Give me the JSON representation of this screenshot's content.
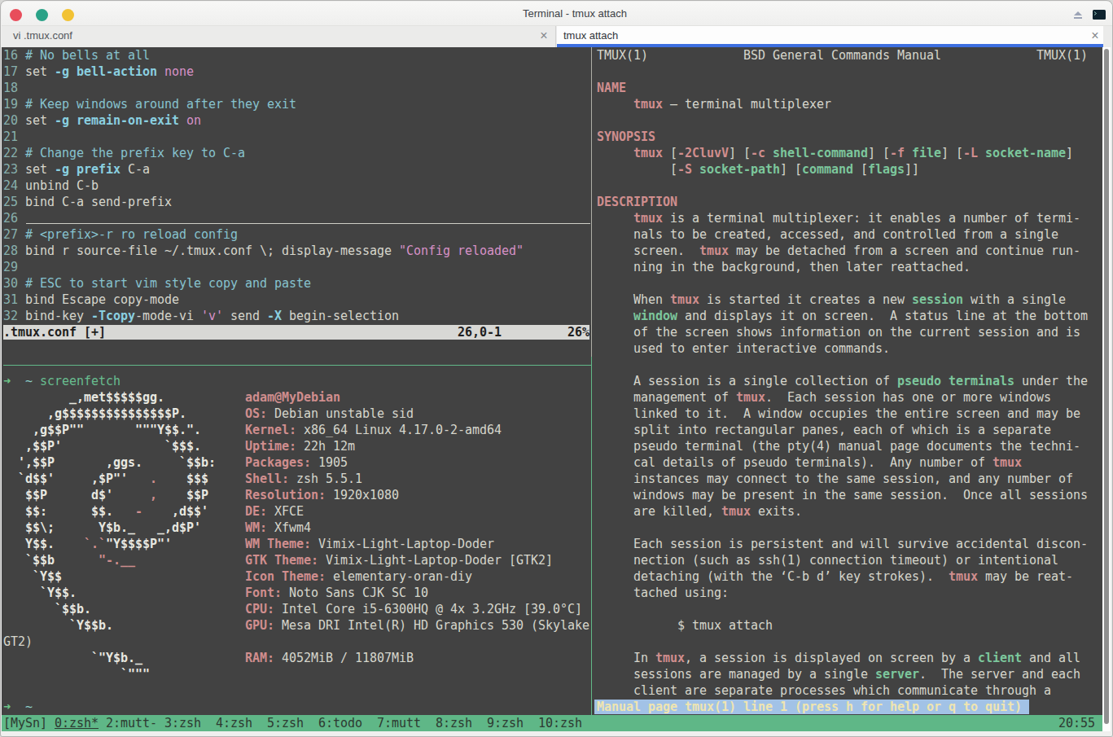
{
  "window": {
    "title": "Terminal - tmux attach",
    "controls": {
      "close": "close",
      "maximize": "maximize",
      "minimize": "minimize"
    },
    "icons": [
      "shade-icon",
      "terminal-app-icon"
    ]
  },
  "tabs": [
    {
      "label": "vi .tmux.conf",
      "close_label": "×",
      "active": false
    },
    {
      "label": "tmux attach",
      "close_label": "×",
      "active": true
    }
  ],
  "colors": {
    "terminal_bg": "#424242",
    "foreground": "#d6d6cc",
    "accent_blue_tab": "#3d6fe0",
    "tmux_statusbar_green": "#5fb787",
    "pager_highlight_blue": "#a2c2e6",
    "salmon": "#d08e8e",
    "green_bold": "#7cc79c",
    "cyan_keyword": "#8ad0e0",
    "pink": "#d791c7",
    "traffic_red": "#e84d5b",
    "traffic_green": "#2aa287",
    "traffic_yellow": "#f2c233"
  },
  "terminal": {
    "vim_pane": {
      "rows": [
        [
          [
            "ln",
            "16 "
          ],
          [
            "cm",
            "# No bells at all"
          ]
        ],
        [
          [
            "ln",
            "17 "
          ],
          [
            "d",
            "set "
          ],
          [
            "kw",
            "-g"
          ],
          [
            "d",
            " "
          ],
          [
            "kw",
            "bell-action"
          ],
          [
            "d",
            " "
          ],
          [
            "pk",
            "none"
          ]
        ],
        [
          [
            "ln",
            "18"
          ]
        ],
        [
          [
            "ln",
            "19 "
          ],
          [
            "cm",
            "# Keep windows around after they exit"
          ]
        ],
        [
          [
            "ln",
            "20 "
          ],
          [
            "d",
            "set "
          ],
          [
            "kw",
            "-g"
          ],
          [
            "d",
            " "
          ],
          [
            "kw",
            "remain-on-exit"
          ],
          [
            "d",
            " "
          ],
          [
            "pk",
            "on"
          ]
        ],
        [
          [
            "ln",
            "21"
          ]
        ],
        [
          [
            "ln",
            "22 "
          ],
          [
            "cm",
            "# Change the prefix key to C-a"
          ]
        ],
        [
          [
            "ln",
            "23 "
          ],
          [
            "d",
            "set "
          ],
          [
            "kw",
            "-g"
          ],
          [
            "d",
            " "
          ],
          [
            "kw",
            "prefix"
          ],
          [
            "d",
            " C-a"
          ]
        ],
        [
          [
            "ln",
            "24 "
          ],
          [
            "d",
            "unbind C-b"
          ]
        ],
        [
          [
            "ln",
            "25 "
          ],
          [
            "d",
            "bind C-a send-prefix"
          ]
        ],
        [
          [
            "ln",
            "26 "
          ]
        ],
        [
          [
            "ln",
            "27 "
          ],
          [
            "cm",
            "# <prefix>-r ro reload config"
          ]
        ],
        [
          [
            "ln",
            "28 "
          ],
          [
            "d",
            "bind r source-file ~/.tmux.conf \\; display-message "
          ],
          [
            "pk",
            "\"Config reloaded\""
          ]
        ],
        [
          [
            "ln",
            "29"
          ]
        ],
        [
          [
            "ln",
            "30 "
          ],
          [
            "cm",
            "# ESC to start vim style copy and paste"
          ]
        ],
        [
          [
            "ln",
            "31 "
          ],
          [
            "d",
            "bind Escape copy-mode"
          ]
        ],
        [
          [
            "ln",
            "32 "
          ],
          [
            "d",
            "bind-key "
          ],
          [
            "kw",
            "-Tcopy"
          ],
          [
            "d",
            "-mode-vi "
          ],
          [
            "pk",
            "'v'"
          ],
          [
            "d",
            " send "
          ],
          [
            "kw",
            "-X"
          ],
          [
            "d",
            " begin-selection"
          ]
        ],
        [
          [
            "vsl",
            ".tmux.conf [+]                                                26,0-1         26%"
          ]
        ],
        []
      ]
    },
    "shell_pane": {
      "rows": [
        [
          [
            "ga",
            "➜  "
          ],
          [
            "cy",
            "~"
          ],
          [
            "d",
            " "
          ],
          [
            "gc",
            "screenfetch"
          ]
        ],
        [
          [
            "wb",
            "         _,met$$$$$gg."
          ],
          [
            "d",
            "           "
          ],
          [
            "sb",
            "adam@MyDebian"
          ]
        ],
        [
          [
            "wb",
            "      ,g$$$$$$$$$$$$$$$P."
          ],
          [
            "d",
            "        "
          ],
          [
            "sb",
            "OS: "
          ],
          [
            "d",
            "Debian unstable sid"
          ]
        ],
        [
          [
            "wb",
            "    ,g$$P\"\"       \"\"\"Y$$.\"."
          ],
          [
            "d",
            "      "
          ],
          [
            "sb",
            "Kernel: "
          ],
          [
            "d",
            "x86_64 Linux 4.17.0-2-amd64"
          ]
        ],
        [
          [
            "wb",
            "   ,$$P'              `$$$."
          ],
          [
            "d",
            "      "
          ],
          [
            "sb",
            "Uptime: "
          ],
          [
            "d",
            "22h 12m"
          ]
        ],
        [
          [
            "wb",
            "  ',$$P       ,ggs.     `$$b:"
          ],
          [
            "d",
            "    "
          ],
          [
            "sb",
            "Packages: "
          ],
          [
            "d",
            "1905"
          ]
        ],
        [
          [
            "wb",
            "  `d$$'     ,$P\"'   "
          ],
          [
            "rb",
            "."
          ],
          [
            "wb",
            "    $$$"
          ],
          [
            "d",
            "     "
          ],
          [
            "sb",
            "Shell: "
          ],
          [
            "d",
            "zsh 5.5.1"
          ]
        ],
        [
          [
            "wb",
            "   $$P      d$'     "
          ],
          [
            "rb",
            ","
          ],
          [
            "wb",
            "    $$P"
          ],
          [
            "d",
            "     "
          ],
          [
            "sb",
            "Resolution: "
          ],
          [
            "d",
            "1920x1080"
          ]
        ],
        [
          [
            "wb",
            "   $$:      $$.   "
          ],
          [
            "rb",
            "-"
          ],
          [
            "wb",
            "    ,d$$'"
          ],
          [
            "d",
            "     "
          ],
          [
            "sb",
            "DE: "
          ],
          [
            "d",
            "XFCE"
          ]
        ],
        [
          [
            "wb",
            "   $$\\;      Y$b._   _,d$P'"
          ],
          [
            "d",
            "      "
          ],
          [
            "sb",
            "WM: "
          ],
          [
            "d",
            "Xfwm4"
          ]
        ],
        [
          [
            "wb",
            "   Y$$.    "
          ],
          [
            "rb",
            "`.`"
          ],
          [
            "wb",
            "\"Y$$$$P\"'"
          ],
          [
            "d",
            "          "
          ],
          [
            "sb",
            "WM Theme: "
          ],
          [
            "d",
            "Vimix-Light-Laptop-Doder"
          ]
        ],
        [
          [
            "wb",
            "   `$$b      "
          ],
          [
            "rb",
            "\"-.__"
          ],
          [
            "d",
            "               "
          ],
          [
            "sb",
            "GTK Theme: "
          ],
          [
            "d",
            "Vimix-Light-Laptop-Doder [GTK2]"
          ]
        ],
        [
          [
            "wb",
            "    `Y$$"
          ],
          [
            "d",
            "                         "
          ],
          [
            "sb",
            "Icon Theme: "
          ],
          [
            "d",
            "elementary-oran-diy"
          ]
        ],
        [
          [
            "wb",
            "     `Y$$."
          ],
          [
            "d",
            "                       "
          ],
          [
            "sb",
            "Font: "
          ],
          [
            "d",
            "Noto Sans CJK SC 10"
          ]
        ],
        [
          [
            "wb",
            "       `$$b."
          ],
          [
            "d",
            "                     "
          ],
          [
            "sb",
            "CPU: "
          ],
          [
            "d",
            "Intel Core i5-6300HQ @ 4x 3.2GHz [39.0°C]"
          ]
        ],
        [
          [
            "wb",
            "         `Y$$b."
          ],
          [
            "d",
            "                  "
          ],
          [
            "sb",
            "GPU: "
          ],
          [
            "d",
            "Mesa DRI Intel(R) HD Graphics 530 (Skylake"
          ]
        ],
        [
          [
            "d",
            "GT2)"
          ]
        ],
        [
          [
            "wb",
            "            `\"Y$b._"
          ],
          [
            "d",
            "              "
          ],
          [
            "sb",
            "RAM: "
          ],
          [
            "d",
            "4052MiB / 11807MiB"
          ]
        ],
        [
          [
            "wb",
            "                `\"\"\""
          ]
        ],
        [],
        [
          [
            "ga",
            "➜  "
          ],
          [
            "cy",
            "~"
          ]
        ]
      ]
    },
    "man_pane": {
      "rows": [
        [
          [
            "d",
            "TMUX(1)             BSD General Commands Manual             TMUX(1)"
          ]
        ],
        [],
        [
          [
            "sb",
            "NAME"
          ]
        ],
        [
          [
            "d",
            "     "
          ],
          [
            "sb",
            "tmux"
          ],
          [
            "d",
            " — terminal multiplexer"
          ]
        ],
        [],
        [
          [
            "sb",
            "SYNOPSIS"
          ]
        ],
        [
          [
            "d",
            "     "
          ],
          [
            "sb",
            "tmux"
          ],
          [
            "d",
            " ["
          ],
          [
            "sb",
            "-2CluvV"
          ],
          [
            "d",
            "] ["
          ],
          [
            "sb",
            "-c"
          ],
          [
            "d",
            " "
          ],
          [
            "gb",
            "shell-command"
          ],
          [
            "d",
            "] ["
          ],
          [
            "sb",
            "-f"
          ],
          [
            "d",
            " "
          ],
          [
            "gb",
            "file"
          ],
          [
            "d",
            "] ["
          ],
          [
            "sb",
            "-L"
          ],
          [
            "d",
            " "
          ],
          [
            "gb",
            "socket-name"
          ],
          [
            "d",
            "]"
          ]
        ],
        [
          [
            "d",
            "          ["
          ],
          [
            "sb",
            "-S"
          ],
          [
            "d",
            " "
          ],
          [
            "gb",
            "socket-path"
          ],
          [
            "d",
            "] ["
          ],
          [
            "gb",
            "command"
          ],
          [
            "d",
            " ["
          ],
          [
            "gb",
            "flags"
          ],
          [
            "d",
            "]]"
          ]
        ],
        [],
        [
          [
            "sb",
            "DESCRIPTION"
          ]
        ],
        [
          [
            "d",
            "     "
          ],
          [
            "sb",
            "tmux"
          ],
          [
            "d",
            " is a terminal multiplexer: it enables a number of termi-"
          ]
        ],
        [
          [
            "d",
            "     nals to be created, accessed, and controlled from a single"
          ]
        ],
        [
          [
            "d",
            "     screen.  "
          ],
          [
            "sb",
            "tmux"
          ],
          [
            "d",
            " may be detached from a screen and continue run-"
          ]
        ],
        [
          [
            "d",
            "     ning in the background, then later reattached."
          ]
        ],
        [],
        [
          [
            "d",
            "     When "
          ],
          [
            "sb",
            "tmux"
          ],
          [
            "d",
            " is started it creates a new "
          ],
          [
            "gb",
            "session"
          ],
          [
            "d",
            " with a single"
          ]
        ],
        [
          [
            "d",
            "     "
          ],
          [
            "gb",
            "window"
          ],
          [
            "d",
            " and displays it on screen.  A status line at the bottom"
          ]
        ],
        [
          [
            "d",
            "     of the screen shows information on the current session and is"
          ]
        ],
        [
          [
            "d",
            "     used to enter interactive commands."
          ]
        ],
        [],
        [
          [
            "d",
            "     A session is a single collection of "
          ],
          [
            "gb",
            "pseudo terminals"
          ],
          [
            "d",
            " under the"
          ]
        ],
        [
          [
            "d",
            "     management of "
          ],
          [
            "sb",
            "tmux"
          ],
          [
            "d",
            ".  Each session has one or more windows"
          ]
        ],
        [
          [
            "d",
            "     linked to it.  A window occupies the entire screen and may be"
          ]
        ],
        [
          [
            "d",
            "     split into rectangular panes, each of which is a separate"
          ]
        ],
        [
          [
            "d",
            "     pseudo terminal (the pty(4) manual page documents the techni-"
          ]
        ],
        [
          [
            "d",
            "     cal details of pseudo terminals).  Any number of "
          ],
          [
            "sb",
            "tmux"
          ]
        ],
        [
          [
            "d",
            "     instances may connect to the same session, and any number of"
          ]
        ],
        [
          [
            "d",
            "     windows may be present in the same session.  Once all sessions"
          ]
        ],
        [
          [
            "d",
            "     are killed, "
          ],
          [
            "sb",
            "tmux"
          ],
          [
            "d",
            " exits."
          ]
        ],
        [],
        [
          [
            "d",
            "     Each session is persistent and will survive accidental discon-"
          ]
        ],
        [
          [
            "d",
            "     nection (such as ssh(1) connection timeout) or intentional"
          ]
        ],
        [
          [
            "d",
            "     detaching (with the ‘C-b d’ key strokes).  "
          ],
          [
            "sb",
            "tmux"
          ],
          [
            "d",
            " may be reat-"
          ]
        ],
        [
          [
            "d",
            "     tached using:"
          ]
        ],
        [],
        [
          [
            "d",
            "           $ tmux attach"
          ]
        ],
        [],
        [
          [
            "d",
            "     In "
          ],
          [
            "sb",
            "tmux"
          ],
          [
            "d",
            ", a session is displayed on screen by a "
          ],
          [
            "gb",
            "client"
          ],
          [
            "d",
            " and all"
          ]
        ],
        [
          [
            "d",
            "     sessions are managed by a single "
          ],
          [
            "gb",
            "server"
          ],
          [
            "d",
            ".  The server and each"
          ]
        ],
        [
          [
            "d",
            "     client are separate processes which communicate through a"
          ]
        ],
        [
          [
            "pg",
            "Manual page tmux(1) line 1 (press h for help or q to quit) "
          ]
        ]
      ]
    },
    "status_bar": {
      "row": [
        [
          "tm",
          "[MySn] "
        ],
        [
          "tmu",
          "0:zsh*"
        ],
        [
          "tm",
          " 2:mutt- 3:zsh  4:zsh  5:zsh  6:todo  7:mutt  8:zsh  9:zsh  10:zsh"
        ],
        [
          "tm",
          "                                                                 20:55"
        ]
      ],
      "session": "[MySn]",
      "time": "20:55"
    }
  }
}
